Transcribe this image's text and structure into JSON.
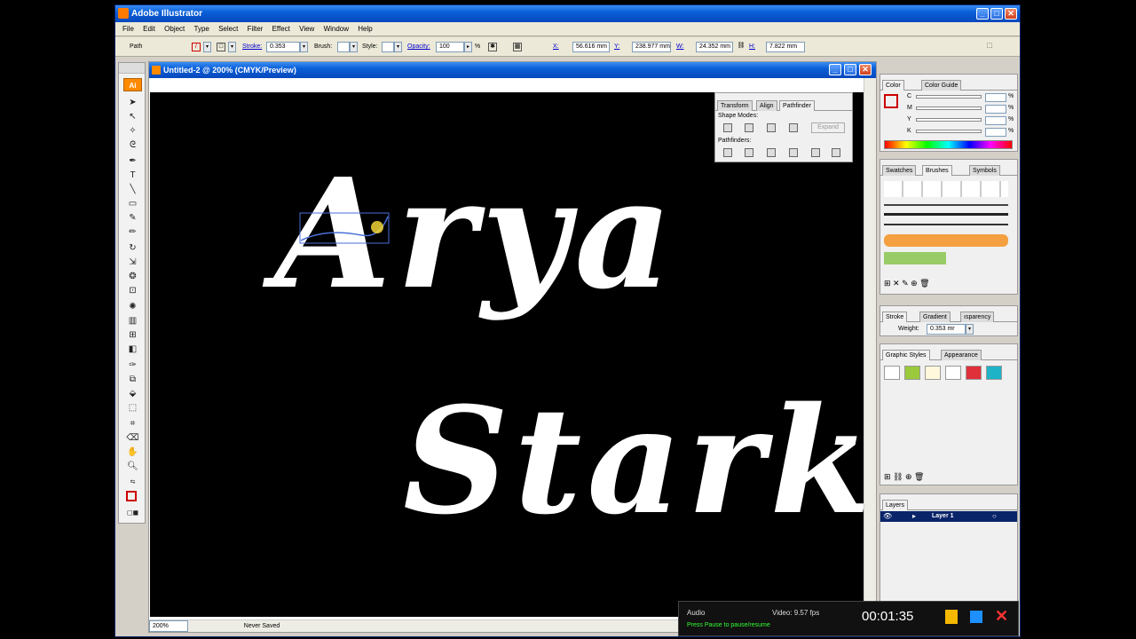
{
  "app": {
    "title": "Adobe Illustrator"
  },
  "menu": [
    "File",
    "Edit",
    "Object",
    "Type",
    "Select",
    "Filter",
    "Effect",
    "View",
    "Window",
    "Help"
  ],
  "control": {
    "selection": "Path",
    "stroke_label": "Stroke:",
    "stroke_value": "0.353",
    "brush_label": "Brush:",
    "style_label": "Style:",
    "opacity_label": "Opacity:",
    "opacity_value": "100",
    "opacity_unit": "%",
    "x_label": "X:",
    "x_value": "56.616 mm",
    "y_label": "Y:",
    "y_value": "238.977 mm",
    "w_label": "W:",
    "w_value": "24.352 mm",
    "h_label": "H:",
    "h_value": "7.822 mm"
  },
  "document": {
    "title": "Untitled-2 @ 200% (CMYK/Preview)",
    "zoom": "200%",
    "status": "Never Saved",
    "art_line1": "Arya",
    "art_line2": "Stark"
  },
  "pathfinder": {
    "tabs": [
      "Transform",
      "Align",
      "Pathfinder"
    ],
    "shape_modes": "Shape Modes:",
    "expand": "Expand",
    "pathfinders": "Pathfinders:"
  },
  "color_panel": {
    "tabs": [
      "Color",
      "Color Guide"
    ],
    "channels": [
      "C",
      "M",
      "Y",
      "K"
    ],
    "unit": "%"
  },
  "brushes_panel": {
    "tabs": [
      "Swatches",
      "Brushes",
      "Symbols"
    ]
  },
  "stroke_panel": {
    "tabs": [
      "Stroke",
      "Gradient",
      "ısparency"
    ],
    "weight_label": "Weight:",
    "weight_value": "0.353 mr"
  },
  "graphic_styles": {
    "tabs": [
      "Graphic Styles",
      "Appearance"
    ],
    "colors": [
      "#ffffff",
      "#9ac93c",
      "#fff8dc",
      "#ffffff",
      "#e0303a",
      "#1fb3c8"
    ]
  },
  "layers": {
    "tab": "Layers",
    "layer_name": "Layer 1",
    "highlight": "#0a246a"
  },
  "recorder": {
    "audio": "Audio",
    "video": "Video: 9.57 fps",
    "timer": "00:01:35",
    "hint": "Press Pause to pause/resume"
  }
}
